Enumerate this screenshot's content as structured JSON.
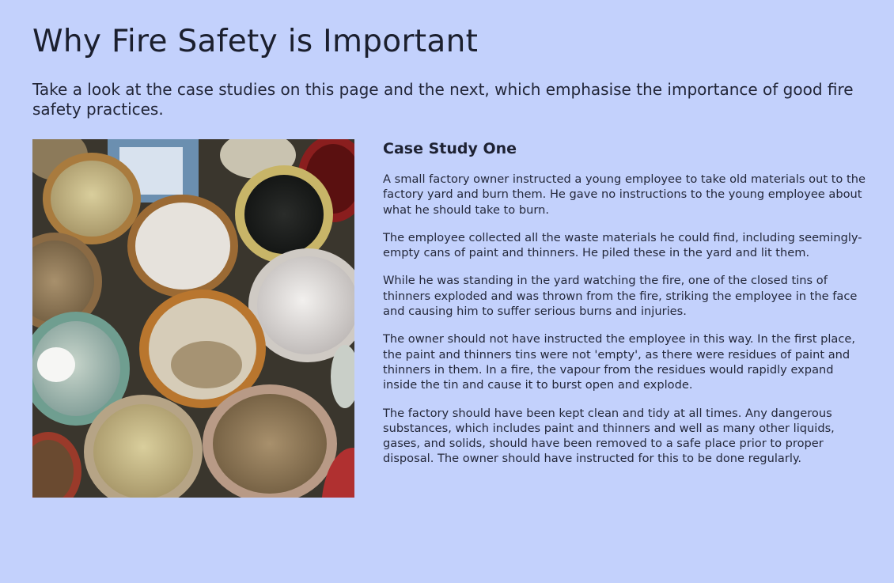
{
  "page": {
    "title": "Why Fire Safety is Important",
    "intro": "Take a look at the case studies on this page and the next, which emphasise the importance of good fire safety practices."
  },
  "case_study": {
    "heading": "Case Study One",
    "paragraphs": [
      "A small factory owner instructed a young employee to take old materials out to the factory yard and burn them. He gave no instructions to the young employee about what he should take to burn.",
      "The employee collected all the waste materials he could find, including seemingly-empty cans of paint and thinners. He piled these in the yard and lit them.",
      "While he was standing in the yard watching the fire, one of the closed tins of thinners exploded and was thrown from the fire, striking the employee in the face and causing him to suffer serious burns and injuries.",
      "The owner should not have instructed the employee in this way. In the first place, the paint and thinners tins were not 'empty', as there were residues of paint and thinners in them. In a fire, the vapour from the residues would rapidly expand inside the tin and cause it to burst open and explode.",
      "The factory should have been kept clean and tidy at all times. Any dangerous substances, which includes paint and thinners and well as many other liquids, gases, and solids, should have been removed to a safe place prior to proper disposal. The owner should have instructed for this to be done regularly."
    ]
  },
  "colors": {
    "background": "#c3d1fc",
    "text": "#1e2233"
  }
}
